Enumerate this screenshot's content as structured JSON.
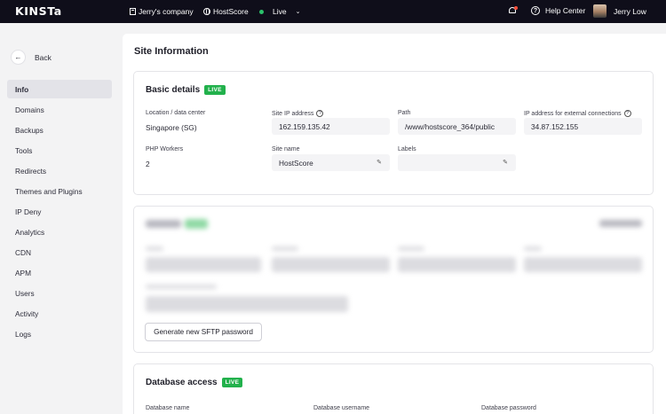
{
  "topbar": {
    "logo": "KINSTa",
    "company": "Jerry's company",
    "site": "HostScore",
    "environment": "Live",
    "help": "Help Center",
    "user": "Jerry Low",
    "env_color": "#2bc26b"
  },
  "sidebar": {
    "back_label": "Back",
    "items": [
      {
        "label": "Info",
        "active": true
      },
      {
        "label": "Domains"
      },
      {
        "label": "Backups"
      },
      {
        "label": "Tools"
      },
      {
        "label": "Redirects"
      },
      {
        "label": "Themes and Plugins"
      },
      {
        "label": "IP Deny"
      },
      {
        "label": "Analytics"
      },
      {
        "label": "CDN"
      },
      {
        "label": "APM"
      },
      {
        "label": "Users"
      },
      {
        "label": "Activity"
      },
      {
        "label": "Logs"
      }
    ]
  },
  "main": {
    "title": "Site Information",
    "basic": {
      "title": "Basic details",
      "badge": "LIVE",
      "location_label": "Location / data center",
      "location_value": "Singapore (SG)",
      "ip_label": "Site IP address",
      "ip_value": "162.159.135.42",
      "path_label": "Path",
      "path_value": "/www/hostscore_364/public",
      "ext_ip_label": "IP address for external connections",
      "ext_ip_value": "34.87.152.155",
      "php_label": "PHP Workers",
      "php_value": "2",
      "sitename_label": "Site name",
      "sitename_value": "HostScore",
      "labels_label": "Labels",
      "labels_value": ""
    },
    "sftp": {
      "generate_button": "Generate new SFTP password"
    },
    "database": {
      "title": "Database access",
      "badge": "LIVE",
      "name_label": "Database name",
      "username_label": "Database username",
      "password_label": "Database password"
    }
  },
  "colors": {
    "topbar_bg": "#0f0e1a",
    "badge_green": "#22b14c"
  }
}
